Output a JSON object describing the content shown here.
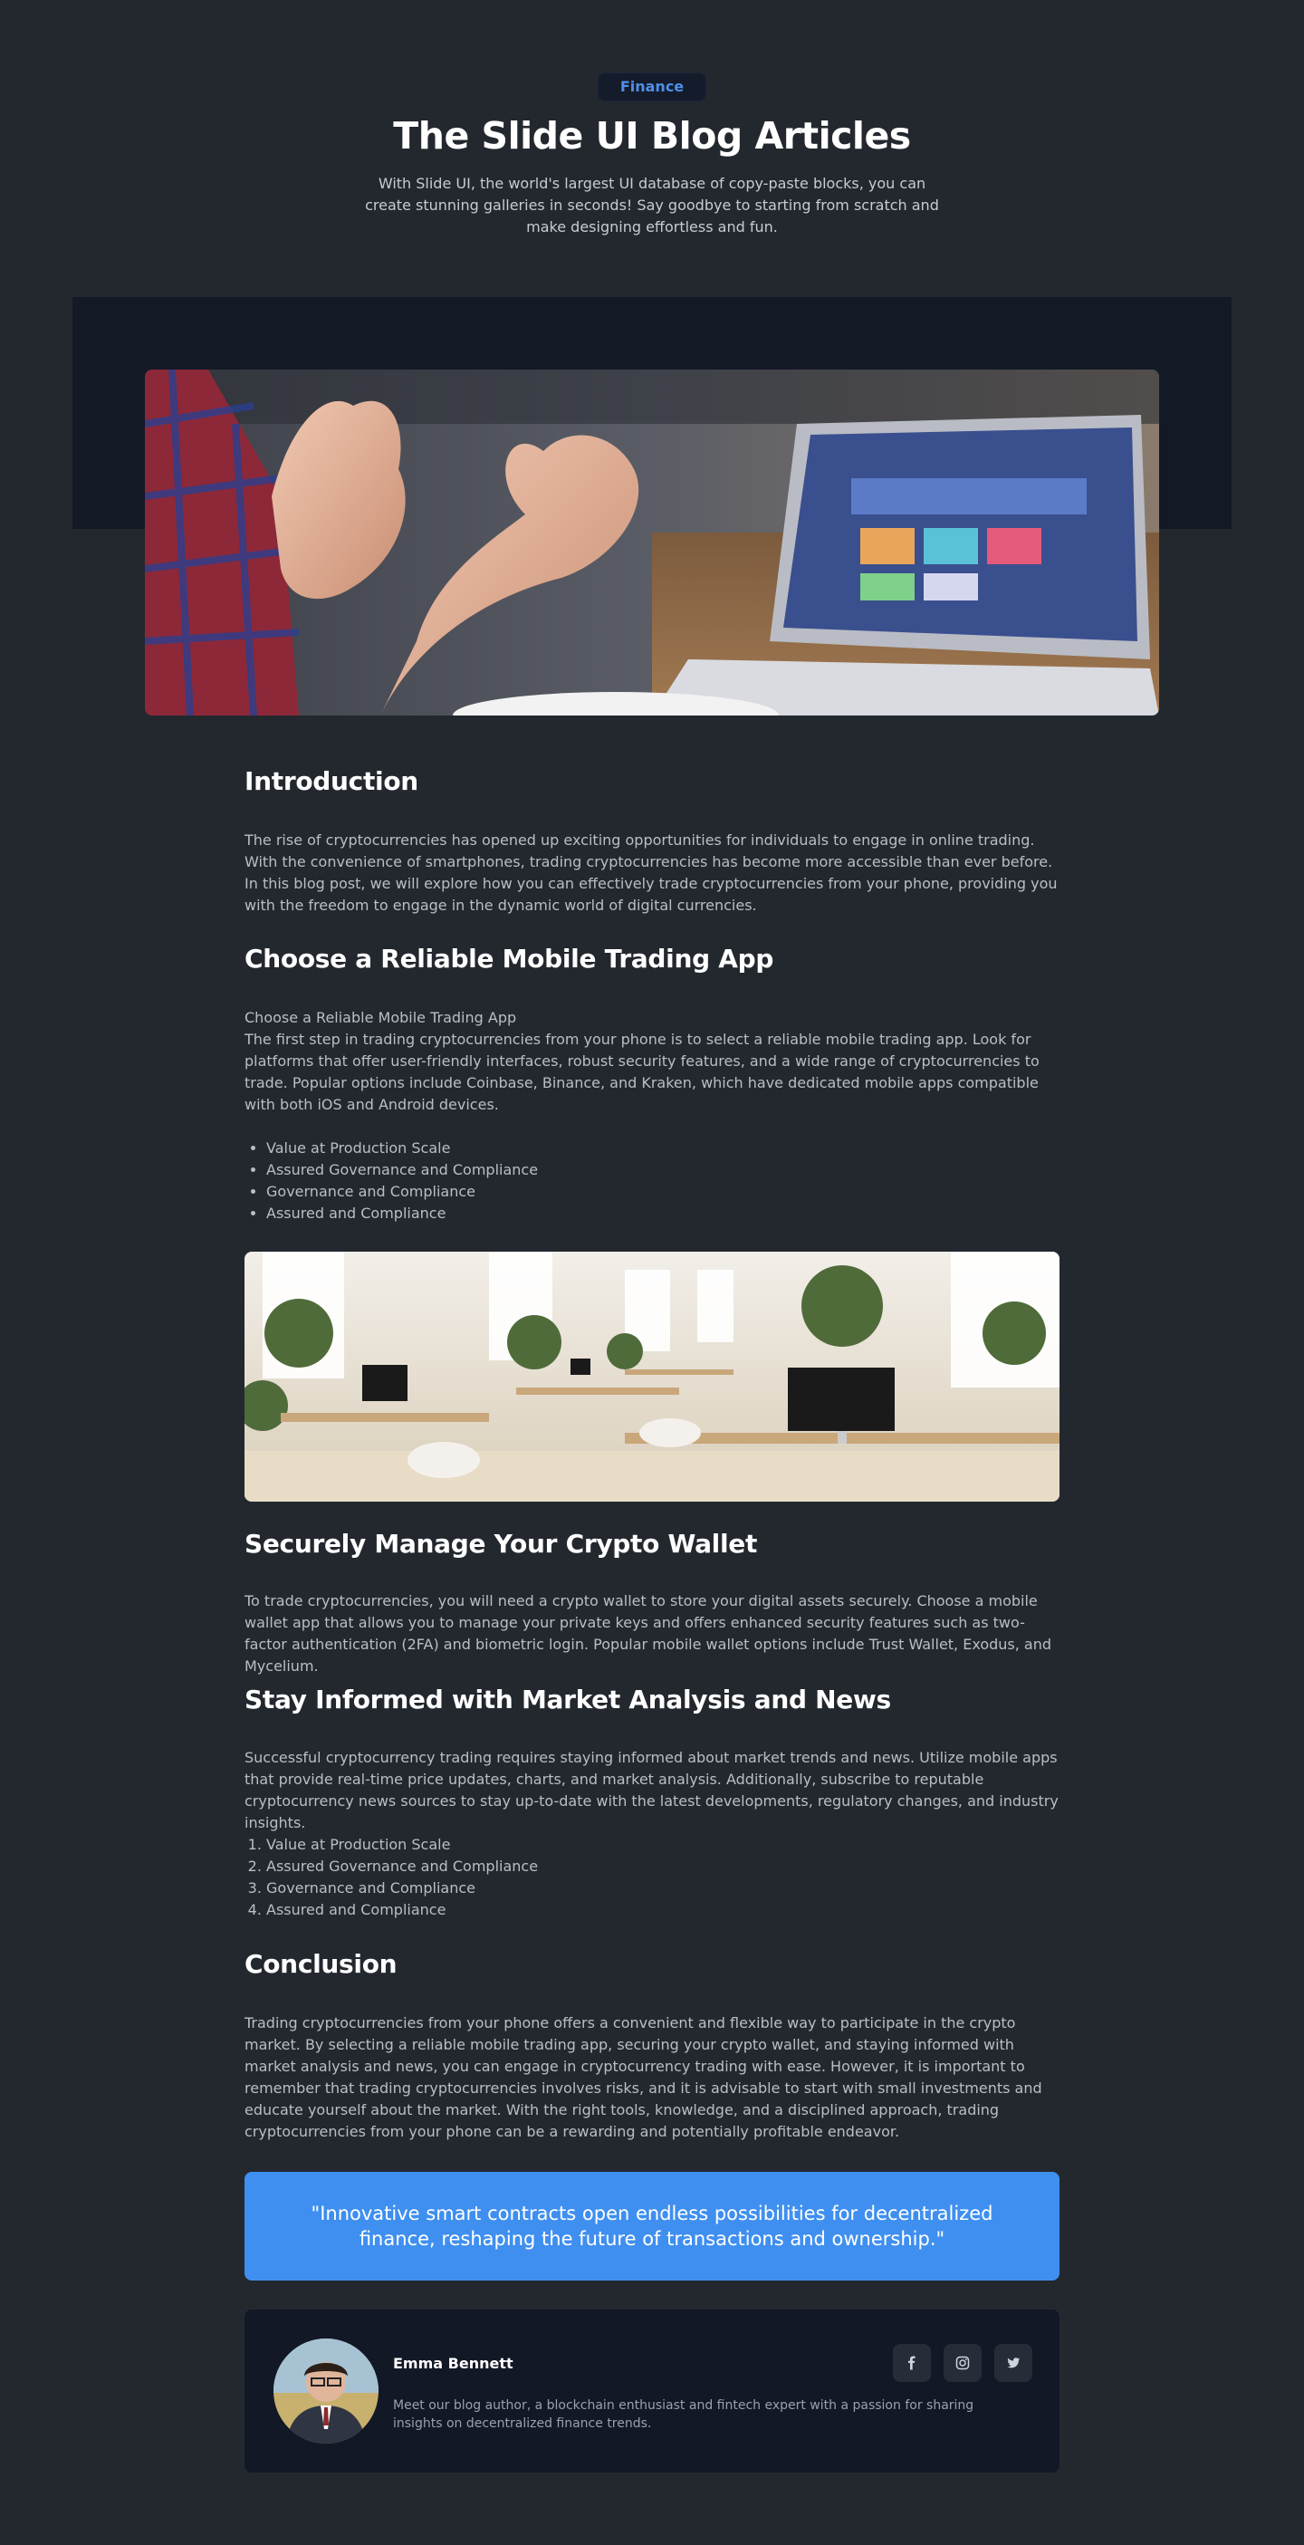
{
  "header": {
    "badge": "Finance",
    "title": "The Slide UI Blog Articles",
    "description": "With Slide UI, the world's largest UI database of copy-paste blocks, you can create stunning galleries in seconds! Say goodbye to starting from scratch and make designing effortless and fun."
  },
  "images": {
    "hero_icon": "hands-laptop-photo",
    "office_icon": "office-workspace-photo"
  },
  "article": {
    "intro": {
      "heading": "Introduction",
      "body": "The rise of cryptocurrencies has opened up exciting opportunities for individuals to engage in online trading. With the convenience of smartphones, trading cryptocurrencies has become more accessible than ever before. In this blog post, we will explore how you can effectively trade cryptocurrencies from your phone, providing you with the freedom to engage in the dynamic world of digital currencies."
    },
    "app": {
      "heading": "Choose a Reliable Mobile Trading App",
      "subtitle": "Choose a Reliable Mobile Trading App",
      "body": "The first step in trading cryptocurrencies from your phone is to select a reliable mobile trading app. Look for platforms that offer user-friendly interfaces, robust security features, and a wide range of cryptocurrencies to trade. Popular options include Coinbase, Binance, and Kraken, which have dedicated mobile apps compatible with both iOS and Android devices.",
      "bullets": [
        "Value at Production Scale",
        "Assured Governance and Compliance",
        "Governance and Compliance",
        "Assured and Compliance"
      ]
    },
    "wallet": {
      "heading": "Securely Manage Your Crypto Wallet",
      "body": "To trade cryptocurrencies, you will need a crypto wallet to store your digital assets securely. Choose a mobile wallet app that allows you to manage your private keys and offers enhanced security features such as two-factor authentication (2FA) and biometric login. Popular mobile wallet options include Trust Wallet, Exodus, and Mycelium."
    },
    "news": {
      "heading": "Stay Informed with Market Analysis and News",
      "body": "Successful cryptocurrency trading requires staying informed about market trends and news. Utilize mobile apps that provide real-time price updates, charts, and market analysis. Additionally, subscribe to reputable cryptocurrency news sources to stay up-to-date with the latest developments, regulatory changes, and industry insights.",
      "numbered": [
        "Value at Production Scale",
        "Assured Governance and Compliance",
        "Governance and Compliance",
        "Assured and Compliance"
      ]
    },
    "conclusion": {
      "heading": "Conclusion",
      "body": "Trading cryptocurrencies from your phone offers a convenient and flexible way to participate in the crypto market. By selecting a reliable mobile trading app, securing your crypto wallet, and staying informed with market analysis and news, you can engage in cryptocurrency trading with ease. However, it is important to remember that trading cryptocurrencies involves risks, and it is advisable to start with small investments and educate yourself about the market. With the right tools, knowledge, and a disciplined approach, trading cryptocurrencies from your phone can be a rewarding and potentially profitable endeavor."
    },
    "quote": "\"Innovative smart contracts open endless possibilities for decentralized finance, reshaping the future of transactions and ownership.\""
  },
  "author": {
    "name": "Emma Bennett",
    "bio": "Meet our blog author, a blockchain enthusiast and fintech expert with a passion for sharing insights on decentralized finance trends.",
    "socials": [
      {
        "icon": "facebook-icon"
      },
      {
        "icon": "instagram-icon"
      },
      {
        "icon": "twitter-icon"
      }
    ]
  },
  "colors": {
    "background": "#23282f",
    "band": "#141926",
    "accent": "#3f8ff0",
    "card": "#121826"
  }
}
